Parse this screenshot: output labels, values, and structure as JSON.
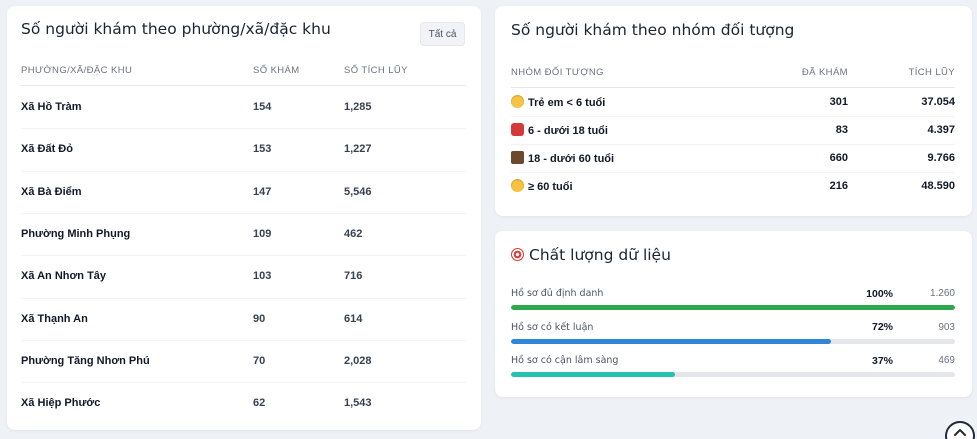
{
  "ward_card": {
    "title": "Số người khám theo phường/xã/đặc khu",
    "all_button": "Tất cả",
    "headers": [
      "Phường/Xã/Đặc khu",
      "Số khám",
      "Số tích lũy"
    ],
    "rows": [
      {
        "name": "Xã Hồ Tràm",
        "visits": "154",
        "cumulative": "1,285"
      },
      {
        "name": "Xã Đất Đỏ",
        "visits": "153",
        "cumulative": "1,227"
      },
      {
        "name": "Xã Bà Điểm",
        "visits": "147",
        "cumulative": "5,546"
      },
      {
        "name": "Phường Minh Phụng",
        "visits": "109",
        "cumulative": "462"
      },
      {
        "name": "Xã An Nhơn Tây",
        "visits": "103",
        "cumulative": "716"
      },
      {
        "name": "Xã Thạnh An",
        "visits": "90",
        "cumulative": "614"
      },
      {
        "name": "Phường Tăng Nhơn Phú",
        "visits": "70",
        "cumulative": "2,028"
      },
      {
        "name": "Xã Hiệp Phước",
        "visits": "62",
        "cumulative": "1,543"
      }
    ]
  },
  "group_card": {
    "title": "Số người khám theo nhóm đối tượng",
    "headers": [
      "Nhóm đối tượng",
      "Đã khám",
      "Tích lũy"
    ],
    "rows": [
      {
        "icon": "baby-emoji-icon",
        "label": "Trẻ em < 6 tuổi",
        "visited": "301",
        "cumulative": "37.054"
      },
      {
        "icon": "backpack-emoji-icon",
        "label": "6 - dưới 18 tuổi",
        "visited": "83",
        "cumulative": "4.397"
      },
      {
        "icon": "briefcase-emoji-icon",
        "label": "18 - dưới 60 tuổi",
        "visited": "660",
        "cumulative": "9.766"
      },
      {
        "icon": "older-person-emoji-icon",
        "label": "≥ 60 tuổi",
        "visited": "216",
        "cumulative": "48.590"
      }
    ]
  },
  "quality_card": {
    "icon": "target-icon",
    "title": "Chất lượng dữ liệu",
    "items": [
      {
        "label": "Hồ sơ đủ định danh",
        "percent": "100%",
        "count": "1.260",
        "fraction": 1.0,
        "color": "#2ea84f"
      },
      {
        "label": "Hồ sơ có kết luận",
        "percent": "72%",
        "count": "903",
        "fraction": 0.72,
        "color": "#2f86d8"
      },
      {
        "label": "Hồ sơ có cận lâm sàng",
        "percent": "37%",
        "count": "469",
        "fraction": 0.37,
        "color": "#22c3b0"
      }
    ]
  },
  "colors": {
    "page_background": "#eef2f7",
    "card_background": "#ffffff"
  },
  "scroll_top_icon": "chevron-up-icon"
}
